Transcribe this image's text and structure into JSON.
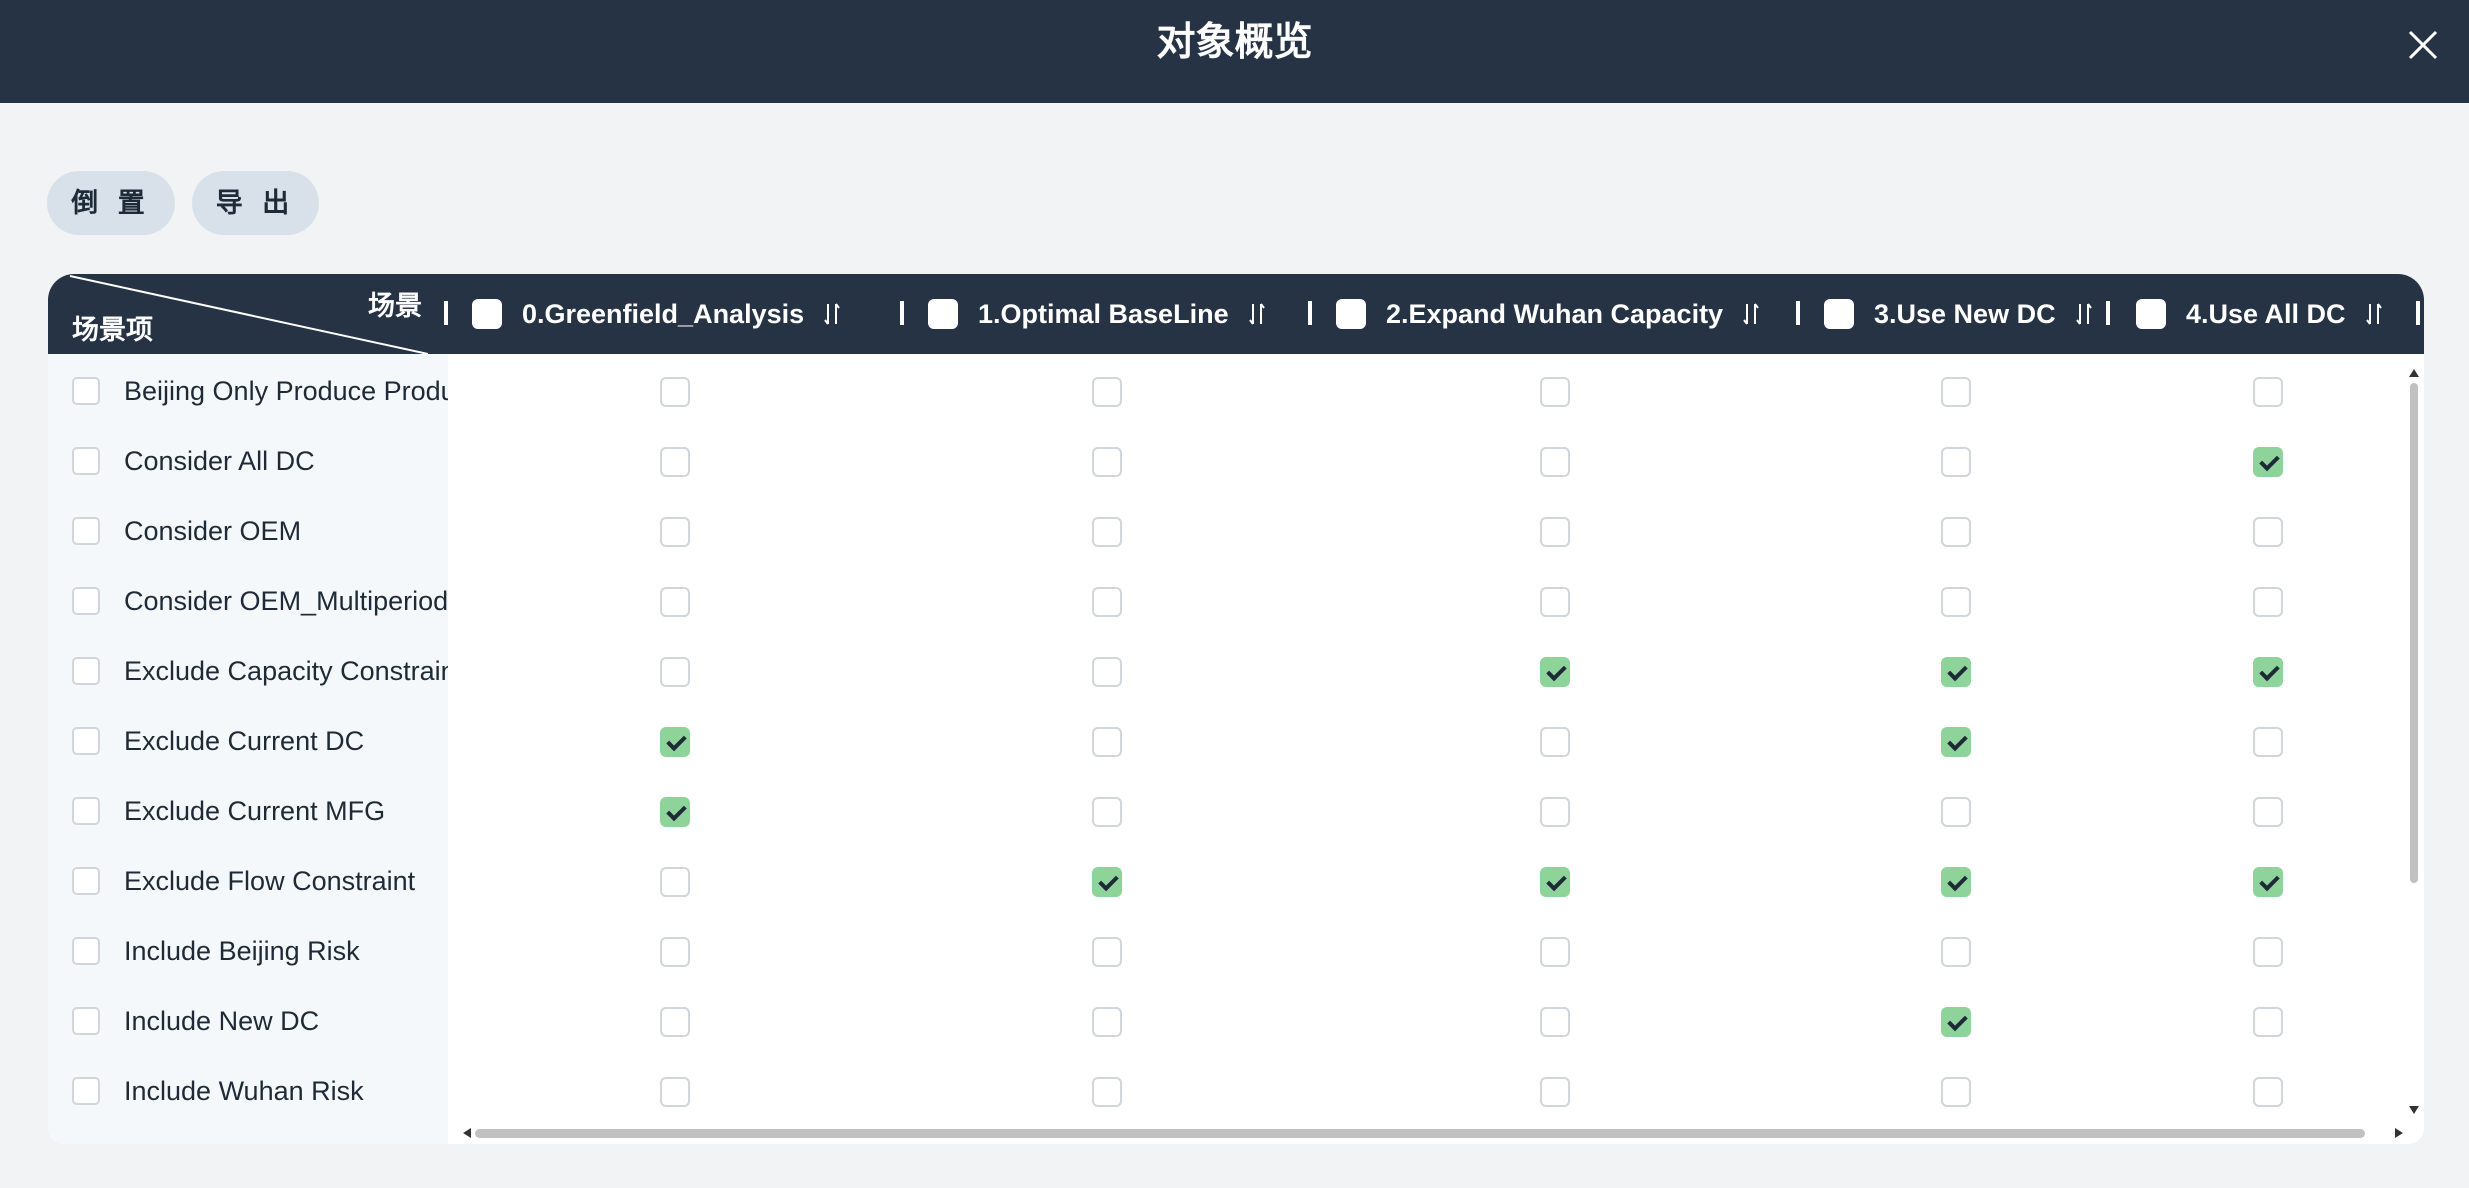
{
  "dialog": {
    "title": "对象概览"
  },
  "toolbar": {
    "invert_label": "倒 置",
    "export_label": "导 出"
  },
  "table": {
    "corner_top_label": "场景",
    "corner_bottom_label": "场景项",
    "columns": [
      {
        "label": "0.Greenfield_Analysis"
      },
      {
        "label": "1.Optimal BaseLine"
      },
      {
        "label": "2.Expand Wuhan Capacity"
      },
      {
        "label": "3.Use New DC"
      },
      {
        "label": "4.Use All DC"
      }
    ],
    "rows": [
      {
        "label": "Beijing Only Produce Product",
        "checks": [
          false,
          false,
          false,
          false,
          false
        ]
      },
      {
        "label": "Consider All DC",
        "checks": [
          false,
          false,
          false,
          false,
          true
        ]
      },
      {
        "label": "Consider OEM",
        "checks": [
          false,
          false,
          false,
          false,
          false
        ]
      },
      {
        "label": "Consider OEM_Multiperiod",
        "checks": [
          false,
          false,
          false,
          false,
          false
        ]
      },
      {
        "label": "Exclude Capacity Constraint",
        "checks": [
          false,
          false,
          true,
          true,
          true
        ]
      },
      {
        "label": "Exclude Current DC",
        "checks": [
          true,
          false,
          false,
          true,
          false
        ]
      },
      {
        "label": "Exclude Current MFG",
        "checks": [
          true,
          false,
          false,
          false,
          false
        ]
      },
      {
        "label": "Exclude Flow Constraint",
        "checks": [
          false,
          true,
          true,
          true,
          true
        ]
      },
      {
        "label": "Include Beijing Risk",
        "checks": [
          false,
          false,
          false,
          false,
          false
        ]
      },
      {
        "label": "Include New DC",
        "checks": [
          false,
          false,
          false,
          true,
          false
        ]
      },
      {
        "label": "Include Wuhan Risk",
        "checks": [
          false,
          false,
          false,
          false,
          false
        ]
      }
    ]
  },
  "icons": {
    "close": "close-icon",
    "sort": "sort-icon"
  },
  "colors": {
    "header": "#253345",
    "checked": "#8ed49a",
    "button": "#d8e1ea"
  }
}
